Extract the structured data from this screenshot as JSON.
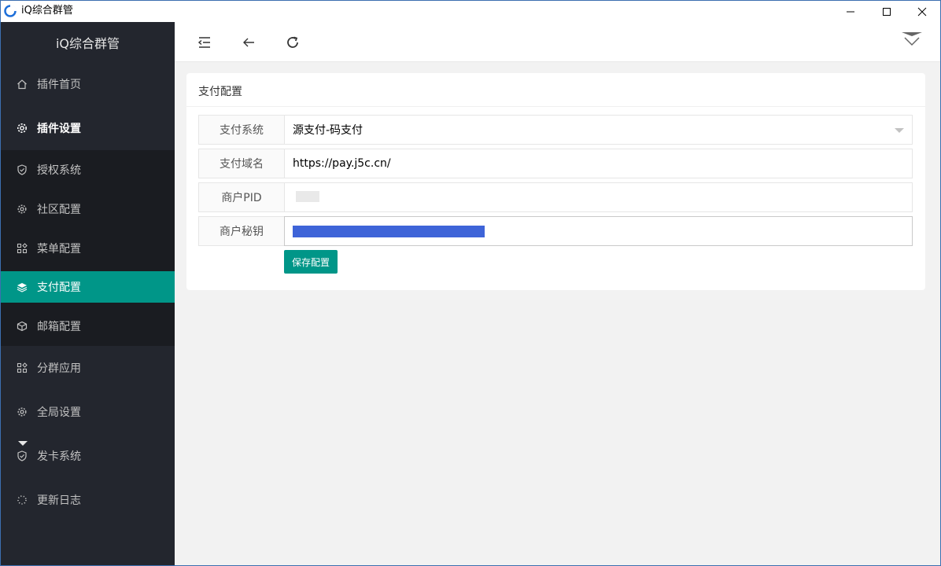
{
  "window": {
    "title": "iQ综合群管"
  },
  "sidebar": {
    "title": "iQ综合群管",
    "items": [
      {
        "label": "插件首页",
        "icon": "home-icon"
      },
      {
        "label": "插件设置",
        "icon": "gear-icon"
      },
      {
        "label": "授权系统",
        "icon": "shield-icon"
      },
      {
        "label": "社区配置",
        "icon": "gear-icon"
      },
      {
        "label": "菜单配置",
        "icon": "app-grid-icon"
      },
      {
        "label": "支付配置",
        "icon": "layers-icon"
      },
      {
        "label": "邮箱配置",
        "icon": "cube-icon"
      },
      {
        "label": "分群应用",
        "icon": "app-grid-icon"
      },
      {
        "label": "全局设置",
        "icon": "gear-icon"
      },
      {
        "label": "发卡系统",
        "icon": "shield-icon"
      },
      {
        "label": "更新日志",
        "icon": "loading-icon"
      }
    ]
  },
  "card": {
    "title": "支付配置",
    "fields": [
      {
        "label": "支付系统",
        "value": "源支付-码支付"
      },
      {
        "label": "支付域名",
        "value": "https://pay.j5c.cn/"
      },
      {
        "label": "商户PID",
        "value": ""
      },
      {
        "label": "商户秘钥",
        "value": ""
      }
    ],
    "save_label": "保存配置"
  },
  "colors": {
    "accent": "#009688",
    "sidebar_bg": "#23262e",
    "sidebar_sub_bg": "#1a1c21"
  }
}
